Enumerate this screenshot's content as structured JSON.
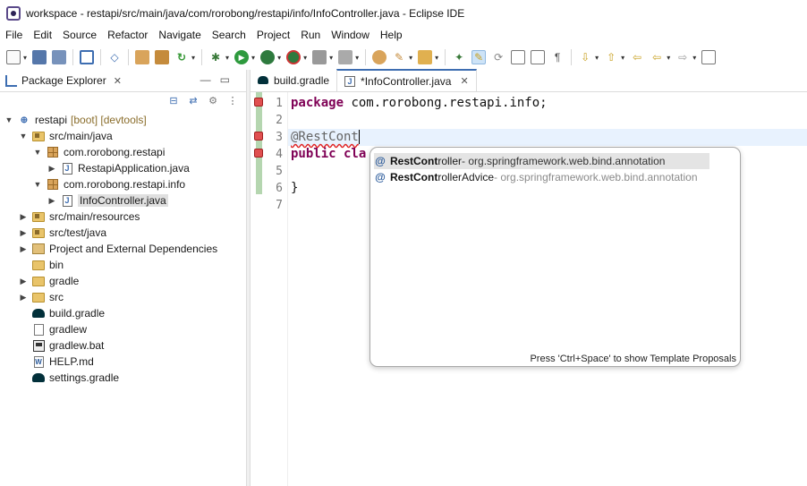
{
  "window": {
    "title": "workspace - restapi/src/main/java/com/rorobong/restapi/info/InfoController.java - Eclipse IDE"
  },
  "menubar": [
    "File",
    "Edit",
    "Source",
    "Refactor",
    "Navigate",
    "Search",
    "Project",
    "Run",
    "Window",
    "Help"
  ],
  "package_explorer": {
    "title": "Package Explorer",
    "tree": [
      {
        "label": "restapi",
        "decor": "[boot] [devtools]",
        "expanded": true,
        "icon": "project-icon"
      },
      {
        "label": "src/main/java",
        "expanded": true,
        "icon": "source-folder-icon"
      },
      {
        "label": "com.rorobong.restapi",
        "expanded": true,
        "icon": "package-icon"
      },
      {
        "label": "RestapiApplication.java",
        "icon": "java-file-icon"
      },
      {
        "label": "com.rorobong.restapi.info",
        "expanded": true,
        "icon": "package-icon"
      },
      {
        "label": "InfoController.java",
        "icon": "java-file-icon",
        "selected": true
      },
      {
        "label": "src/main/resources",
        "icon": "source-folder-icon"
      },
      {
        "label": "src/test/java",
        "icon": "source-folder-icon"
      },
      {
        "label": "Project and External Dependencies",
        "icon": "library-icon"
      },
      {
        "label": "bin",
        "icon": "folder-icon"
      },
      {
        "label": "gradle",
        "icon": "folder-icon"
      },
      {
        "label": "src",
        "icon": "folder-icon"
      },
      {
        "label": "build.gradle",
        "icon": "gradle-icon"
      },
      {
        "label": "gradlew",
        "icon": "file-icon"
      },
      {
        "label": "gradlew.bat",
        "icon": "bat-file-icon"
      },
      {
        "label": "HELP.md",
        "icon": "markdown-file-icon"
      },
      {
        "label": "settings.gradle",
        "icon": "gradle-icon"
      }
    ]
  },
  "editor": {
    "tabs": [
      {
        "label": "build.gradle",
        "active": false
      },
      {
        "label": "*InfoController.java",
        "active": true
      }
    ],
    "line_numbers": [
      "1",
      "2",
      "3",
      "4",
      "5",
      "6",
      "7"
    ],
    "lines": {
      "l1_kw": "package",
      "l1_rest": " com.rorobong.restapi.info;",
      "l3_text": "@RestCont",
      "l4_kw": "public",
      "l4_rest": " cla",
      "l6_text": "}"
    }
  },
  "autocomplete": {
    "items": [
      {
        "name_bold": "RestCont",
        "name_rest": "roller",
        "pkg": " - org.springframework.web.bind.annotation",
        "selected": true
      },
      {
        "name_bold": "RestCont",
        "name_rest": "rollerAdvice",
        "pkg": " - org.springframework.web.bind.annotation",
        "selected": false
      }
    ],
    "footer": "Press 'Ctrl+Space' to show Template Proposals"
  }
}
